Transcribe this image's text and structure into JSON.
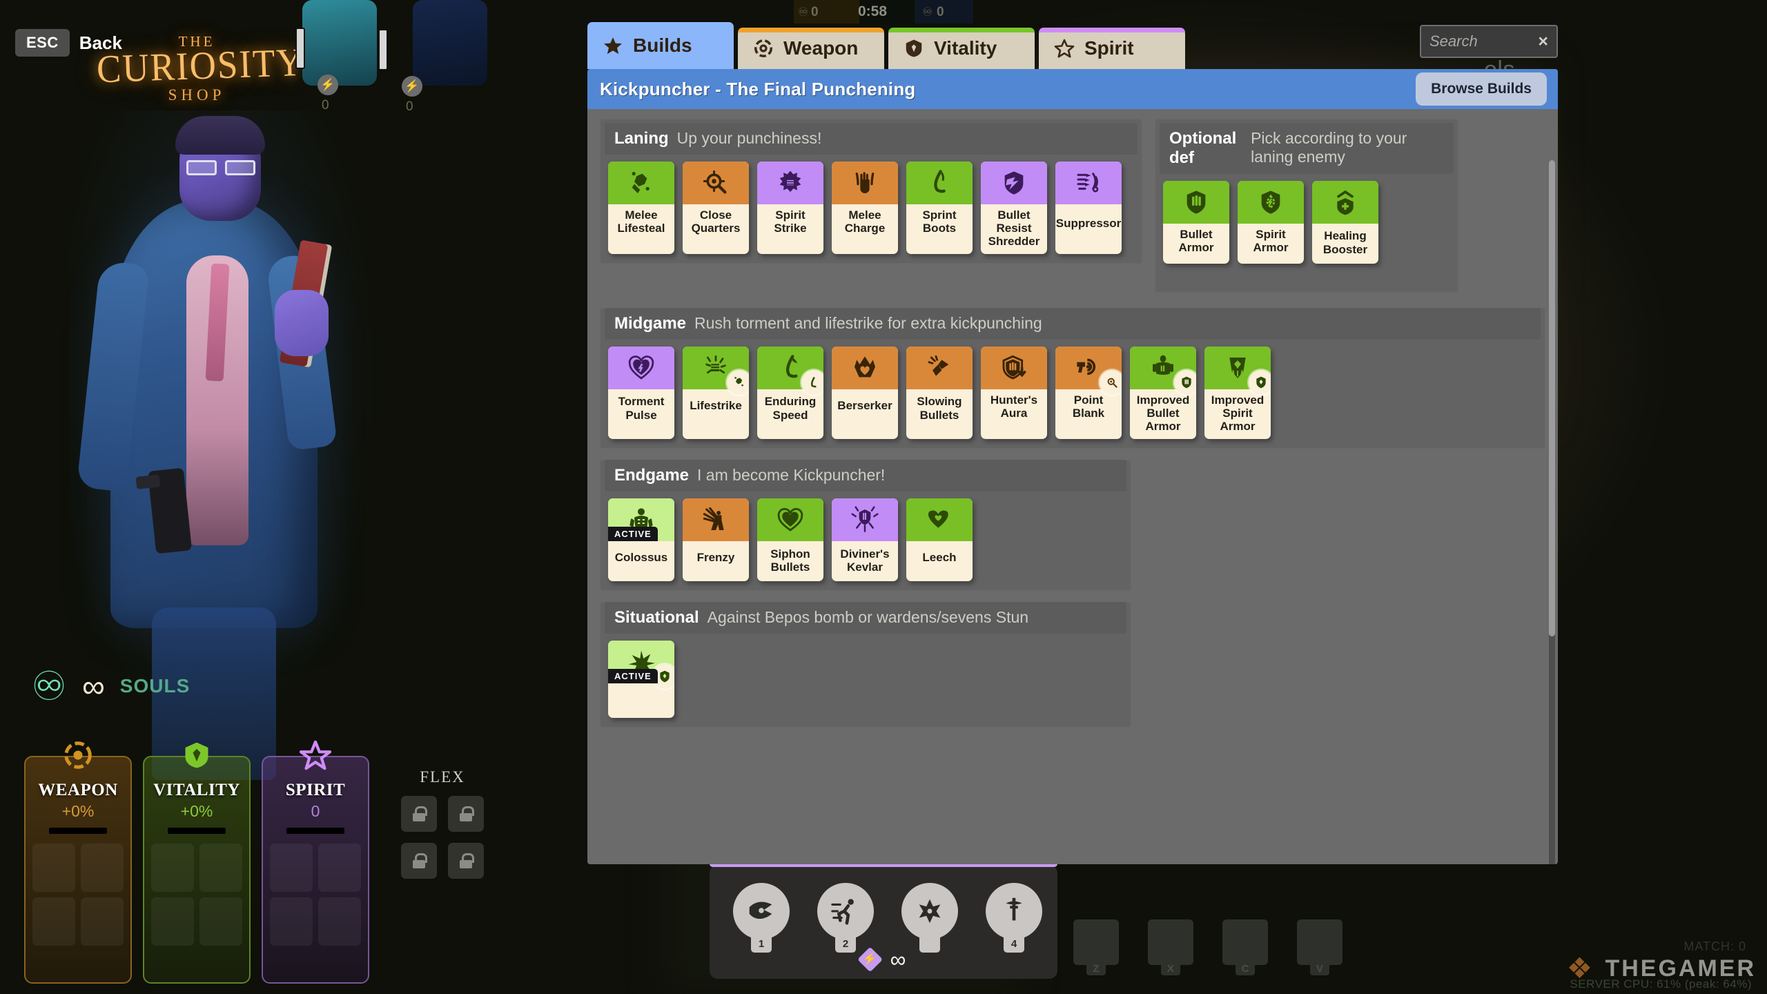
{
  "hud": {
    "esc_key": "ESC",
    "back_label": "Back",
    "shop_logo": {
      "the": "THE",
      "main": "CURIOSITY",
      "sub": "SHOP"
    },
    "timer": "0:58",
    "souls_left": "0",
    "souls_right": "0",
    "ally_souls_1": "0",
    "ally_souls_2": "0",
    "souls_label": "SOULS",
    "souls_value": "∞",
    "flex_label": "FLEX",
    "world_text": "ols",
    "stats": [
      {
        "name": "WEAPON",
        "value": "+0%",
        "icon": "weapon-target-icon"
      },
      {
        "name": "VITALITY",
        "value": "+0%",
        "icon": "vitality-shield-icon"
      },
      {
        "name": "SPIRIT",
        "value": "0",
        "icon": "spirit-star-icon"
      }
    ],
    "abilities": [
      {
        "name": "ability-1",
        "key": "1",
        "icon": "shuriken-dash-icon"
      },
      {
        "name": "ability-2",
        "key": "2",
        "icon": "sprint-runner-icon"
      },
      {
        "name": "ability-3",
        "key": "",
        "icon": "burst-star-icon"
      },
      {
        "name": "ability-4",
        "key": "4",
        "icon": "winged-sword-icon"
      }
    ],
    "ability_center": {
      "diamond": "⚡",
      "infinity": "∞"
    },
    "item_slots": [
      {
        "key": "Z"
      },
      {
        "key": "X"
      },
      {
        "key": "C"
      },
      {
        "key": "V"
      }
    ],
    "watermark": {
      "text": "THEGAMER",
      "server": "SERVER CPU: 61% (peak: 64%)",
      "match": "MATCH: 0"
    }
  },
  "shop": {
    "tabs": [
      {
        "label": "Builds",
        "icon": "star-filled-icon",
        "accent": "#8cb6fa",
        "active": true
      },
      {
        "label": "Weapon",
        "icon": "weapon-target-icon",
        "accent": "#f0a22c",
        "active": false
      },
      {
        "label": "Vitality",
        "icon": "vitality-shield-icon",
        "accent": "#77c62a",
        "active": false
      },
      {
        "label": "Spirit",
        "icon": "spirit-star-icon",
        "accent": "#cf8cf7",
        "active": false
      }
    ],
    "search": {
      "placeholder": "Search",
      "clear": "×"
    },
    "build_title": "Kickpuncher - The Final Punchening",
    "browse_builds": "Browse Builds",
    "sections": [
      {
        "name": "Laning",
        "desc": "Up your punchiness!",
        "items": [
          {
            "label": "Melee Lifesteal",
            "art": "art-green",
            "icon": "fist-gauntlet-plus-icon"
          },
          {
            "label": "Close Quarters",
            "art": "art-orange",
            "icon": "scope-magnifier-icon"
          },
          {
            "label": "Spirit Strike",
            "art": "art-purple",
            "icon": "fist-burst-icon"
          },
          {
            "label": "Melee Charge",
            "art": "art-orange",
            "icon": "raised-fist-icon"
          },
          {
            "label": "Sprint Boots",
            "art": "art-green",
            "icon": "running-leg-icon"
          },
          {
            "label": "Bullet Resist Shredder",
            "art": "art-purple",
            "icon": "shield-break-icon"
          },
          {
            "label": "Suppressor",
            "art": "art-purple",
            "icon": "bullet-waves-icon"
          }
        ]
      },
      {
        "name": "Optional def",
        "desc": "Pick according to your laning enemy",
        "items": [
          {
            "label": "Bullet Armor",
            "art": "art-green",
            "icon": "shield-bullets-icon"
          },
          {
            "label": "Spirit Armor",
            "art": "art-green",
            "icon": "shield-spirit-icon"
          },
          {
            "label": "Healing Booster",
            "art": "art-green",
            "icon": "shield-plus-chevron-icon"
          }
        ]
      },
      {
        "name": "Midgame",
        "desc": "Rush torment and lifestrike for extra kickpunching",
        "items": [
          {
            "label": "Torment Pulse",
            "art": "art-purple",
            "icon": "heart-pulse-icon"
          },
          {
            "label": "Lifestrike",
            "art": "art-green",
            "icon": "fist-impact-icon",
            "component": "fist-gauntlet-plus-icon",
            "component_tone": "cb-green"
          },
          {
            "label": "Enduring Speed",
            "art": "art-green",
            "icon": "winged-boot-icon",
            "component": "running-leg-icon",
            "component_tone": "cb-green"
          },
          {
            "label": "Berserker",
            "art": "art-orange",
            "icon": "heart-spikes-icon"
          },
          {
            "label": "Slowing Bullets",
            "art": "art-orange",
            "icon": "slow-bullet-icon"
          },
          {
            "label": "Hunter's Aura",
            "art": "art-orange",
            "icon": "shield-arrow-down-icon"
          },
          {
            "label": "Point Blank",
            "art": "art-orange",
            "icon": "pistol-target-icon",
            "component": "scope-magnifier-icon",
            "component_tone": "cb-orange"
          },
          {
            "label": "Improved Bullet Armor",
            "art": "art-green",
            "icon": "armor-vest-icon",
            "component": "shield-bullets-icon",
            "component_tone": "cb-green"
          },
          {
            "label": "Improved Spirit Armor",
            "art": "art-green",
            "icon": "armor-spirit-icon",
            "component": "shield-spirit-icon",
            "component_tone": "cb-green"
          }
        ]
      },
      {
        "name": "Endgame",
        "desc": "I am  become Kickpuncher!",
        "items": [
          {
            "label": "Colossus",
            "art": "art-green-l",
            "icon": "giant-figure-icon",
            "badge": "ACTIVE"
          },
          {
            "label": "Frenzy",
            "art": "art-orange",
            "icon": "frenzy-burst-icon"
          },
          {
            "label": "Siphon Bullets",
            "art": "art-green",
            "icon": "heart-siphon-icon"
          },
          {
            "label": "Diviner's Kevlar",
            "art": "art-purple",
            "icon": "shield-rays-icon"
          },
          {
            "label": "Leech",
            "art": "art-green",
            "icon": "heart-leech-icon"
          }
        ]
      },
      {
        "name": "Situational",
        "desc": "Against Bepos bomb or wardens/sevens Stun",
        "items": [
          {
            "label": "",
            "art": "art-green-l",
            "icon": "burst-shatter-icon",
            "badge": "ACTIVE",
            "component": "shield-spirit-icon",
            "component_tone": "cb-green"
          }
        ]
      }
    ]
  }
}
